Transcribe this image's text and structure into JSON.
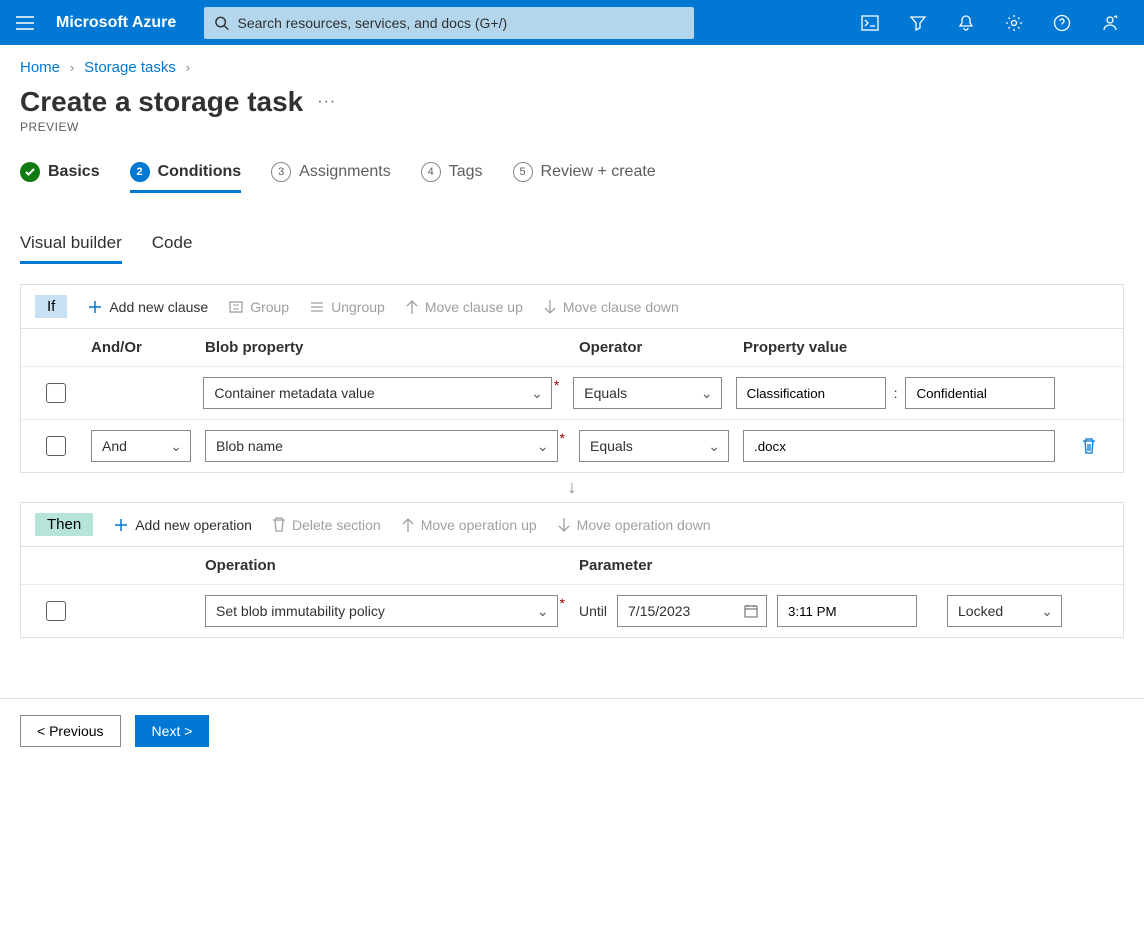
{
  "header": {
    "brand": "Microsoft Azure",
    "search_placeholder": "Search resources, services, and docs (G+/)"
  },
  "breadcrumb": {
    "home": "Home",
    "storage_tasks": "Storage tasks"
  },
  "page": {
    "title": "Create a storage task",
    "subtitle": "PREVIEW"
  },
  "steps": {
    "basics": "Basics",
    "conditions": "Conditions",
    "assignments": "Assignments",
    "tags": "Tags",
    "review": "Review + create",
    "n_assignments": "3",
    "n_tags": "4",
    "n_review": "5"
  },
  "subtabs": {
    "visual": "Visual builder",
    "code": "Code"
  },
  "if_tools": {
    "label": "If",
    "add": "Add new clause",
    "group": "Group",
    "ungroup": "Ungroup",
    "up": "Move clause up",
    "down": "Move clause down"
  },
  "if_headers": {
    "andor": "And/Or",
    "prop": "Blob property",
    "oper": "Operator",
    "val": "Property value"
  },
  "if_row1": {
    "prop": "Container metadata value",
    "oper": "Equals",
    "val_key": "Classification",
    "val_val": "Confidential"
  },
  "if_row2": {
    "andor": "And",
    "prop": "Blob name",
    "oper": "Equals",
    "val": ".docx"
  },
  "then_tools": {
    "label": "Then",
    "add": "Add new operation",
    "del": "Delete section",
    "up": "Move operation up",
    "down": "Move operation down"
  },
  "then_headers": {
    "op": "Operation",
    "param": "Parameter"
  },
  "then_row": {
    "op": "Set blob immutability policy",
    "until": "Until",
    "date": "7/15/2023",
    "time": "3:11 PM",
    "lock": "Locked"
  },
  "footer": {
    "prev": "< Previous",
    "next": "Next >"
  }
}
